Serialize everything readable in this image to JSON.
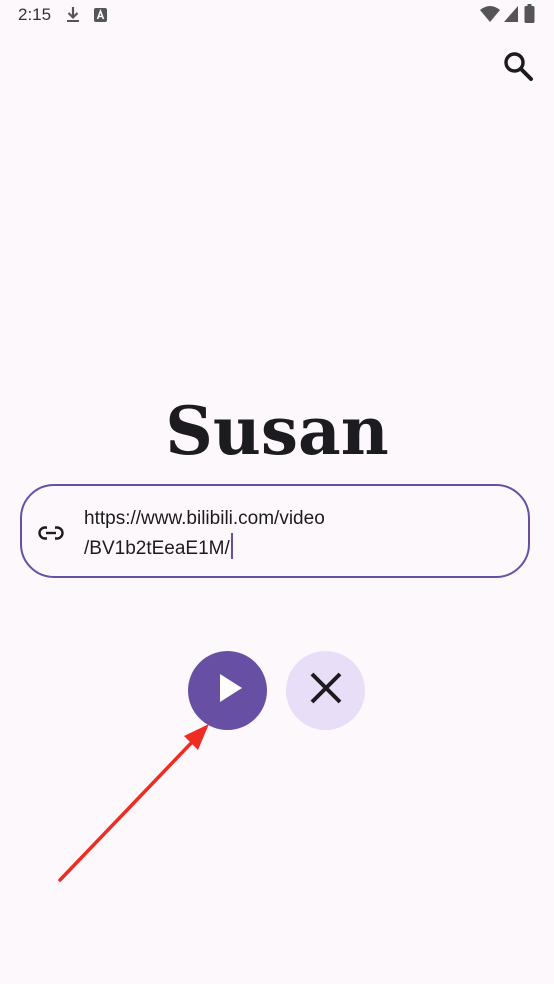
{
  "status_bar": {
    "time": "2:15",
    "icons": [
      "download-icon",
      "a-notification-icon",
      "wifi-icon",
      "cell-signal-icon",
      "battery-icon"
    ]
  },
  "header": {
    "search_icon": "search-icon"
  },
  "main": {
    "title": "Susan",
    "url_field": {
      "value_line1": "https://www.bilibili.com/video",
      "value_line2": "/BV1b2tEeaE1M/",
      "leading_icon": "link-icon"
    },
    "actions": {
      "play_icon": "play-icon",
      "clear_icon": "close-icon"
    }
  },
  "colors": {
    "background": "#fdf8fc",
    "primary": "#6750a4",
    "secondary_container": "#e8def8",
    "annotation": "#ee2c24"
  }
}
